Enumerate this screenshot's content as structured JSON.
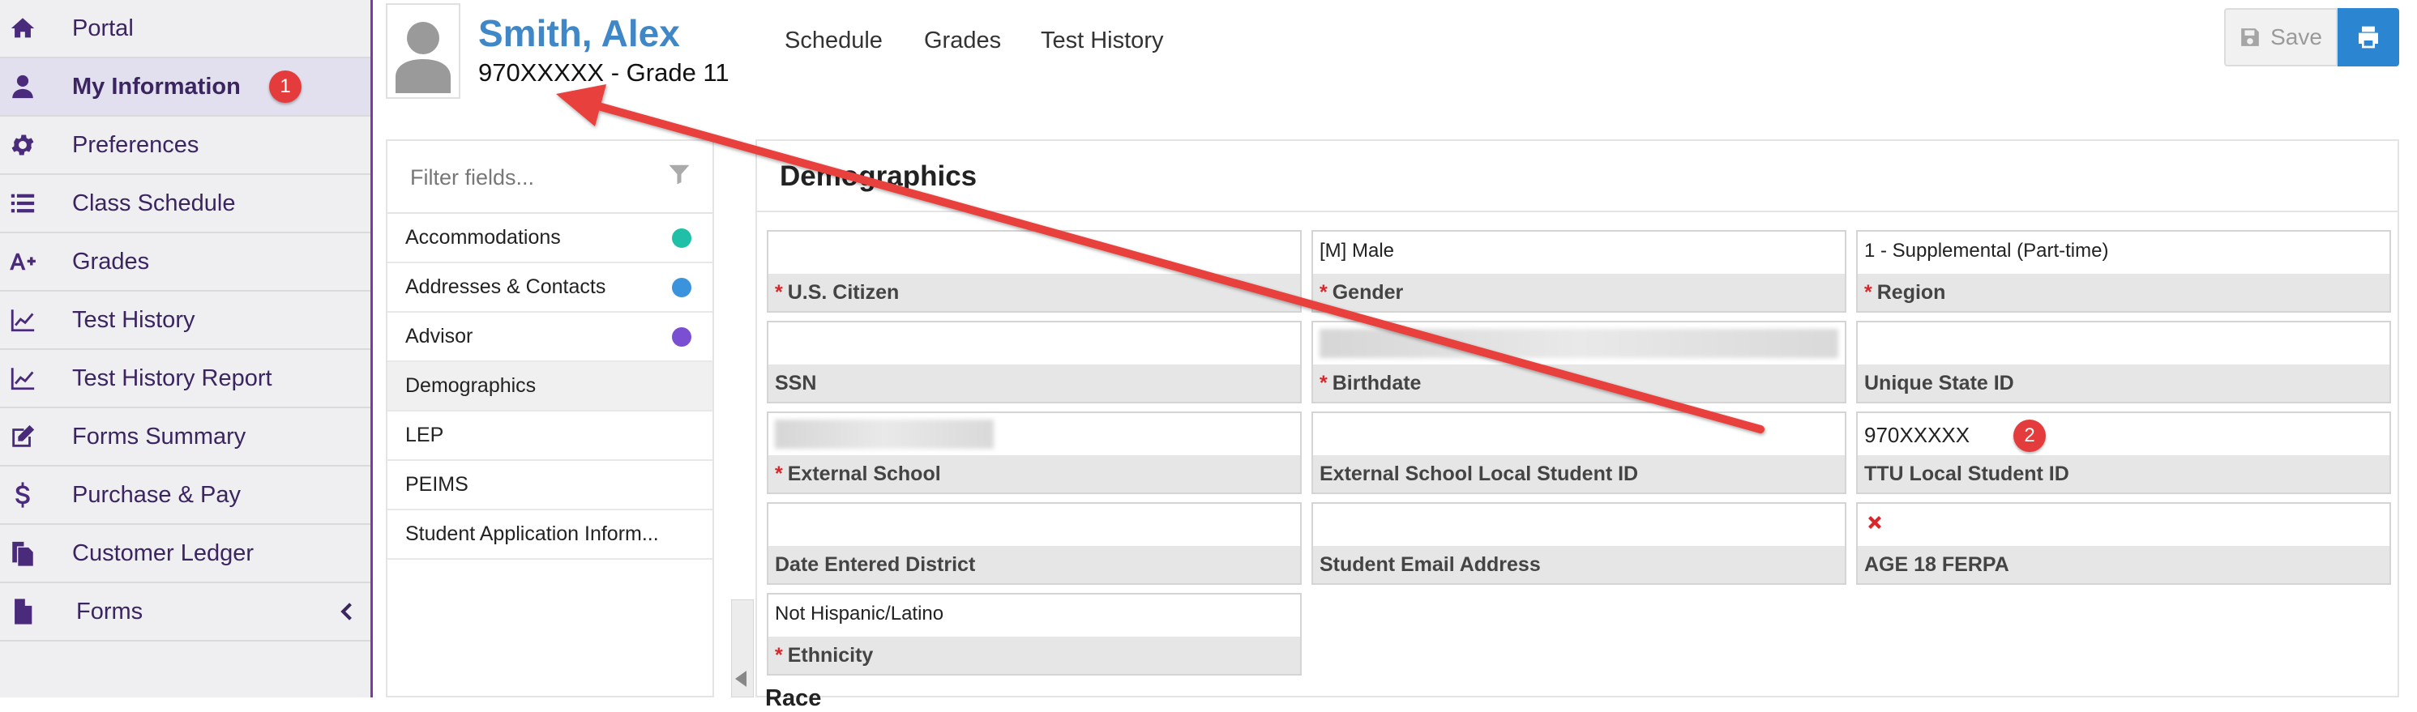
{
  "sidebar": {
    "items": [
      {
        "label": "Portal",
        "icon": "home-icon"
      },
      {
        "label": "My Information",
        "icon": "user-icon",
        "badge": "1"
      },
      {
        "label": "Preferences",
        "icon": "gear-icon"
      },
      {
        "label": "Class Schedule",
        "icon": "list-icon"
      },
      {
        "label": "Grades",
        "icon": "grade-icon"
      },
      {
        "label": "Test History",
        "icon": "chart-line-icon"
      },
      {
        "label": "Test History Report",
        "icon": "chart-line-icon"
      },
      {
        "label": "Forms Summary",
        "icon": "edit-icon"
      },
      {
        "label": "Purchase & Pay",
        "icon": "dollar-icon"
      },
      {
        "label": "Customer Ledger",
        "icon": "ledger-icon"
      },
      {
        "label": "Forms",
        "icon": "file-icon"
      }
    ]
  },
  "header": {
    "name": "Smith, Alex",
    "sub": "970XXXXX - Grade 11",
    "tabs": [
      "Schedule",
      "Grades",
      "Test History"
    ],
    "save_label": "Save"
  },
  "fields_panel": {
    "filter_placeholder": "Filter fields...",
    "items": [
      {
        "label": "Accommodations",
        "dot_color": "#1fbfa8"
      },
      {
        "label": "Addresses & Contacts",
        "dot_color": "#3a93dc"
      },
      {
        "label": "Advisor",
        "dot_color": "#7b4fd1"
      },
      {
        "label": "Demographics"
      },
      {
        "label": "LEP"
      },
      {
        "label": "PEIMS"
      },
      {
        "label": "Student Application Inform..."
      }
    ]
  },
  "demographics": {
    "title": "Demographics",
    "fields": [
      {
        "label": "U.S. Citizen",
        "value": "",
        "required": true
      },
      {
        "label": "Gender",
        "value": "[M] Male",
        "required": true
      },
      {
        "label": "Region",
        "value": "1 - Supplemental (Part-time)",
        "required": true
      },
      {
        "label": "SSN",
        "value": ""
      },
      {
        "label": "Birthdate",
        "value": "",
        "required": true
      },
      {
        "label": "Unique State ID",
        "value": ""
      },
      {
        "label": "External School",
        "value": "",
        "required": true
      },
      {
        "label": "External School Local Student ID",
        "value": ""
      },
      {
        "label": "TTU Local Student ID",
        "value": "970XXXXX",
        "badge": "2"
      },
      {
        "label": "Date Entered District",
        "value": ""
      },
      {
        "label": "Student Email Address",
        "value": ""
      },
      {
        "label": "AGE 18 FERPA",
        "value": ""
      },
      {
        "label": "Ethnicity",
        "value": "Not Hispanic/Latino",
        "required": true
      }
    ],
    "race_label": "Race"
  },
  "colors": {
    "accent": "#3f87c6",
    "sidebar_text": "#3a2560",
    "required": "#d9262b",
    "annotation": "#e43c3c"
  }
}
